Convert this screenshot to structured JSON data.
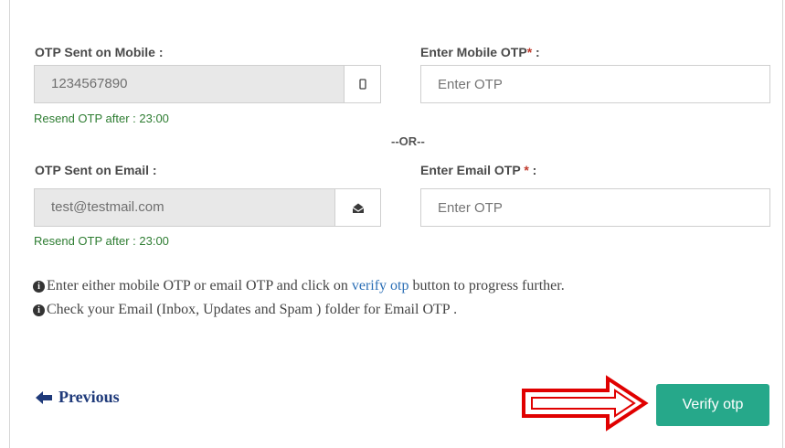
{
  "mobile": {
    "sent_label": "OTP Sent on Mobile :",
    "number": "1234567890",
    "resend": "Resend OTP after : 23:00",
    "enter_label": "Enter Mobile OTP",
    "required_mark": "* :",
    "placeholder": "Enter OTP"
  },
  "separator": "--OR--",
  "email": {
    "sent_label": "OTP Sent on Email :",
    "address": "test@testmail.com",
    "resend": "Resend OTP after : 23:00",
    "enter_label": "Enter Email OTP ",
    "required_mark": "* :",
    "placeholder": "Enter OTP"
  },
  "info": {
    "line1_before": "Enter either mobile OTP or email OTP and click on ",
    "line1_link": "verify otp",
    "line1_after": " button to progress further.",
    "line2": "Check your Email (Inbox, Updates and Spam ) folder for Email OTP ."
  },
  "actions": {
    "previous_label": "Previous",
    "verify_label": "Verify otp"
  },
  "colors": {
    "accent": "#26a88a",
    "resend_text": "#2e7d32",
    "arrow": "#e00000",
    "link": "#2a6eb5"
  },
  "icons": {
    "mobile_addon": "mobile-phone-icon",
    "email_addon": "envelope-open-icon",
    "info": "info-circle-icon",
    "previous": "arrow-left-icon",
    "annotation": "red-outline-arrow"
  }
}
